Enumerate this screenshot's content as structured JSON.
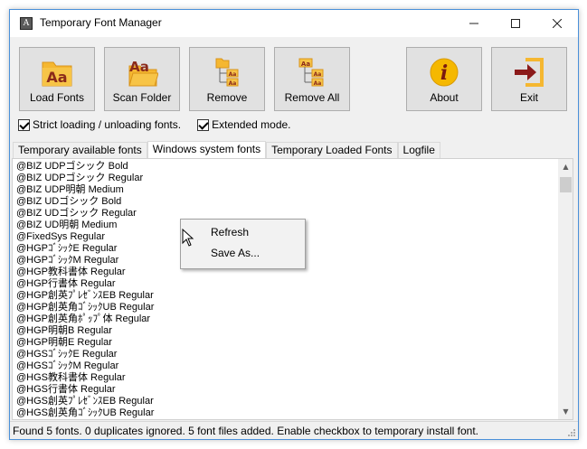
{
  "window": {
    "title": "Temporary Font Manager",
    "app_icon_glyph": "A",
    "controls": {
      "minimize": "—",
      "maximize": "☐",
      "close": "✕"
    }
  },
  "toolbar": {
    "load_fonts": "Load Fonts",
    "scan_folder": "Scan Folder",
    "remove": "Remove",
    "remove_all": "Remove All",
    "about": "About",
    "exit": "Exit",
    "icon_glyph": "Aa",
    "about_glyph": "i"
  },
  "options": {
    "strict_loading": {
      "label": "Strict loading / unloading fonts.",
      "checked": true
    },
    "extended_mode": {
      "label": "Extended mode.",
      "checked": true
    }
  },
  "tabs": [
    {
      "label": "Temporary available fonts",
      "active": false
    },
    {
      "label": "Windows system fonts",
      "active": true
    },
    {
      "label": "Temporary Loaded Fonts",
      "active": false
    },
    {
      "label": "Logfile",
      "active": false
    }
  ],
  "font_list": [
    "@BIZ UDPゴシック Bold",
    "@BIZ UDPゴシック Regular",
    "@BIZ UDP明朝 Medium",
    "@BIZ UDゴシック Bold",
    "@BIZ UDゴシック Regular",
    "@BIZ UD明朝 Medium",
    "@FixedSys Regular",
    "@HGPｺﾞｼｯｸE Regular",
    "@HGPｺﾞｼｯｸM Regular",
    "@HGP教科書体 Regular",
    "@HGP行書体 Regular",
    "@HGP創英ﾌﾟﾚｾﾞﾝｽEB Regular",
    "@HGP創英角ｺﾞｼｯｸUB Regular",
    "@HGP創英角ﾎﾟｯﾌﾟ体 Regular",
    "@HGP明朝B Regular",
    "@HGP明朝E Regular",
    "@HGSｺﾞｼｯｸE Regular",
    "@HGSｺﾞｼｯｸM Regular",
    "@HGS教科書体 Regular",
    "@HGS行書体 Regular",
    "@HGS創英ﾌﾟﾚｾﾞﾝｽEB Regular",
    "@HGS創英角ｺﾞｼｯｸUB Regular"
  ],
  "context_menu": {
    "refresh": "Refresh",
    "save_as": "Save As..."
  },
  "scrollbar": {
    "up": "▲",
    "down": "▼"
  },
  "status": {
    "text": "Found 5 fonts.  0 duplicates ignored.  5 font files added.  Enable checkbox to temporary install font."
  },
  "colors": {
    "folder": "#f5b731",
    "folder_dark": "#d9941a",
    "font_glyph": "#8b2a1a",
    "about": "#f5b800",
    "exit_arrow": "#8b1a1a"
  }
}
